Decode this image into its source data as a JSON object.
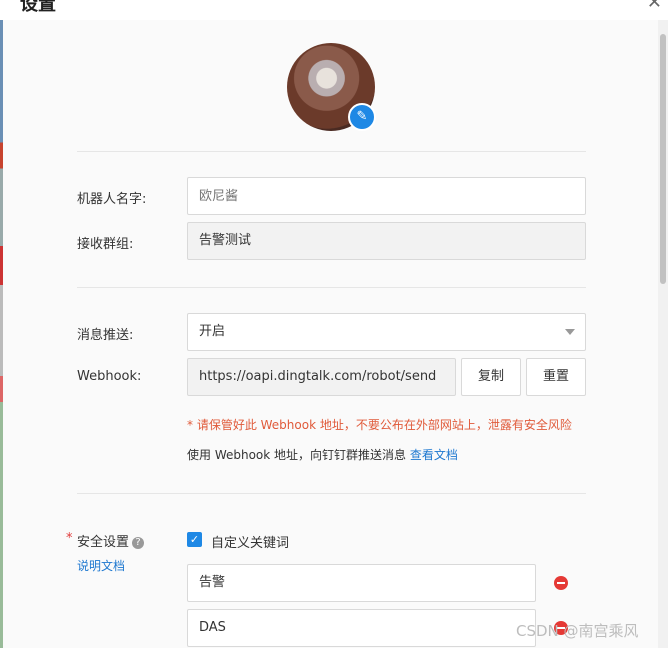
{
  "dialog": {
    "title": "设置"
  },
  "form": {
    "robot_name_label": "机器人名字:",
    "robot_name_placeholder": "欧尼酱",
    "group_label": "接收群组:",
    "group_value": "告警测试",
    "push_label": "消息推送:",
    "push_value": "开启",
    "webhook_label": "Webhook:",
    "webhook_value": "https://oapi.dingtalk.com/robot/send",
    "copy_button": "复制",
    "reset_button": "重置",
    "webhook_warning": "* 请保管好此 Webhook 地址，不要公布在外部网站上，泄露有安全风险",
    "webhook_note": "使用 Webhook 地址，向钉钉群推送消息",
    "doc_link": "查看文档"
  },
  "security": {
    "label": "安全设置",
    "help_link": "说明文档",
    "checkbox_label": "自定义关键词",
    "keywords": [
      "告警",
      "DAS"
    ]
  },
  "watermark": "CSDN @南宫乘风",
  "icons": {
    "close": "close-icon",
    "edit": "pencil-icon",
    "help": "question-icon",
    "check": "check-icon",
    "remove": "minus-circle-icon",
    "dropdown": "chevron-down-icon"
  }
}
